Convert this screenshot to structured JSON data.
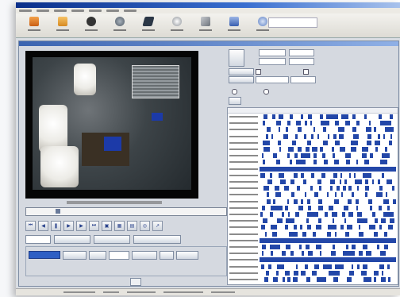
{
  "window": {
    "title": ""
  },
  "menu": {
    "items": [
      "",
      "",
      "",
      "",
      "",
      "",
      "",
      ""
    ]
  },
  "toolbar": {
    "buttons": [
      {
        "label": "",
        "icon": "exit-icon",
        "color": "#e8862a"
      },
      {
        "label": "",
        "icon": "logoff-icon",
        "color": "#e9a53b"
      },
      {
        "label": "",
        "icon": "playback-icon",
        "color": "#4a4a4a"
      },
      {
        "label": "",
        "icon": "audio-icon",
        "color": "#5e6b78"
      },
      {
        "label": "",
        "icon": "control-icon",
        "color": "#2c3a4a"
      },
      {
        "label": "",
        "icon": "search-icon",
        "color": "#8a8f95"
      },
      {
        "label": "",
        "icon": "tools-icon",
        "color": "#7b8088"
      },
      {
        "label": "",
        "icon": "settings-icon",
        "color": "#4a6fc0"
      },
      {
        "label": "",
        "icon": "about-icon",
        "color": "#5c7fc4"
      }
    ],
    "search_placeholder": ""
  },
  "playback": {
    "caption": "",
    "position_fraction": 0.15
  },
  "right_panel": {
    "reset_label": "",
    "from_label": "",
    "to_label": "",
    "camera_label": "",
    "search_label": "",
    "playback_options_label": "",
    "single_screen_label": "",
    "multi_screen_label": "",
    "daily_label": ""
  },
  "timeline": {
    "start_label": "",
    "end_label": "",
    "rows": 26
  },
  "status": {
    "text": ""
  },
  "colors": {
    "accent": "#2347a8",
    "titlebar": "#0a2f8a"
  }
}
